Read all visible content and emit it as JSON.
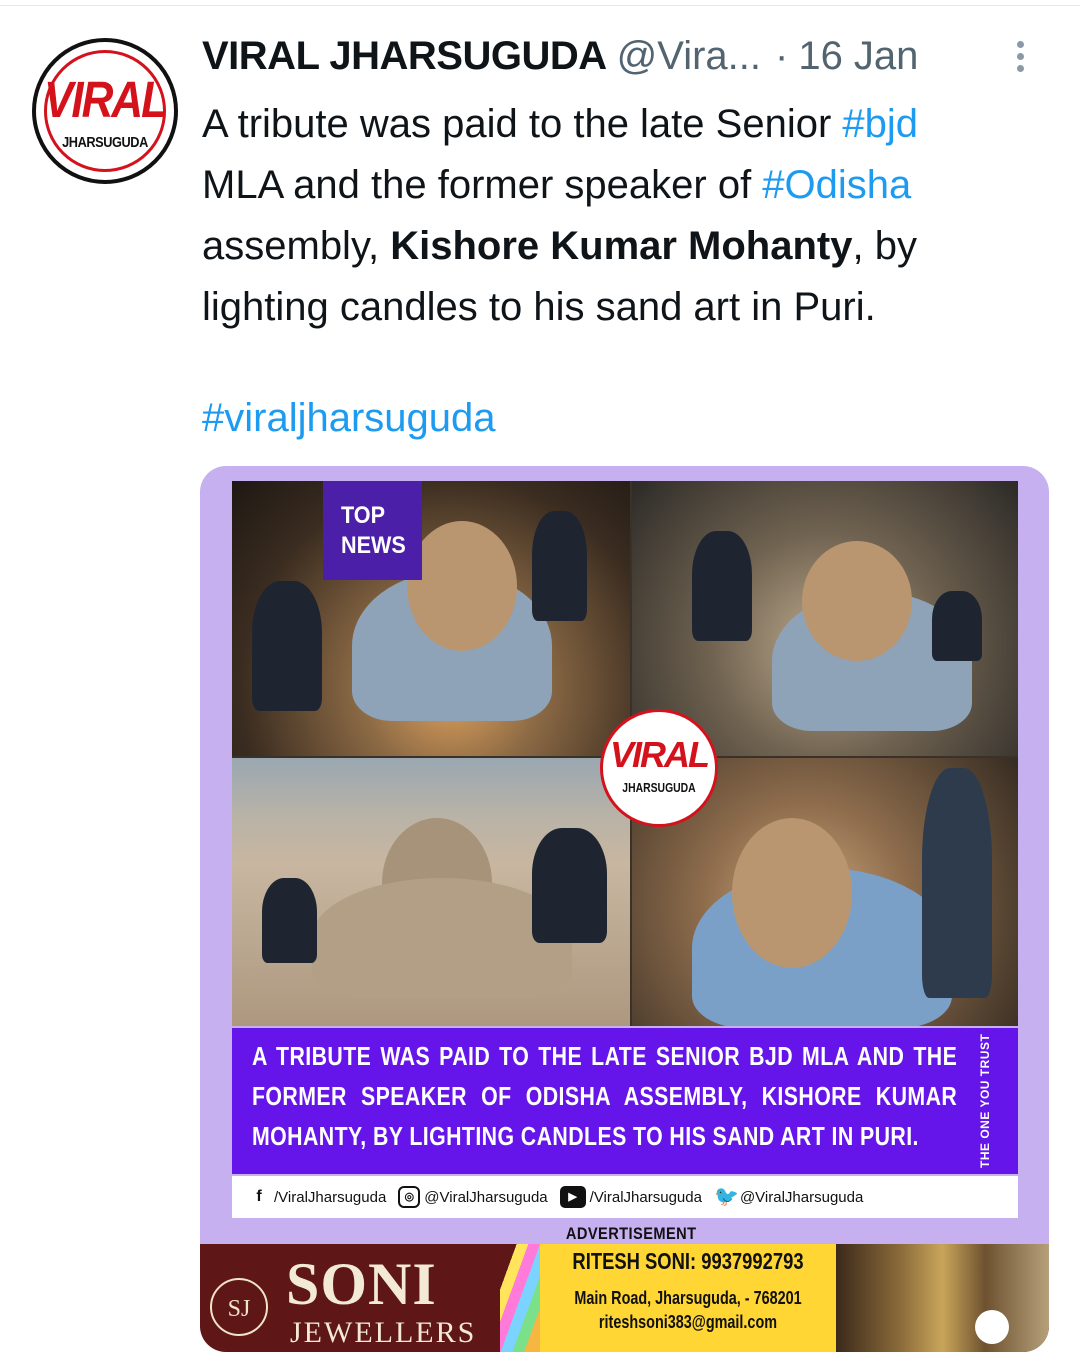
{
  "tweet": {
    "display_name": "VIRAL JHARSUGUDA",
    "handle": "@Vira...",
    "separator": "·",
    "date": "16 Jan",
    "avatar": {
      "line1": "VIRAL",
      "line2": "JHARSUGUDA"
    },
    "text": {
      "l1_pre": "A tribute was paid to the late Senior ",
      "l1_tag": "#bjd",
      "l2_pre": "MLA and the former speaker of ",
      "l2_tag": "#Odisha",
      "l3_pre": "assembly, ",
      "l3_bold": "Kishore Kumar Mohanty",
      "l3_post": ",  by",
      "l4": "lighting candles to his sand art in Puri.",
      "hashtag": "#viraljharsuguda"
    }
  },
  "media": {
    "top_news_line1": "TOP",
    "top_news_line2": "NEWS",
    "center_logo": {
      "line1": "VIRAL",
      "line2": "JHARSUGUDA"
    },
    "banner_text": "A TRIBUTE WAS PAID TO THE LATE SENIOR BJD MLA AND THE FORMER SPEAKER OF ODISHA ASSEMBLY, KISHORE KUMAR MOHANTY, BY LIGHTING CANDLES TO HIS SAND ART IN PURI.",
    "tagline": "THE ONE YOU TRUST",
    "social": {
      "facebook": "/ViralJharsuguda",
      "instagram": "@ViralJharsuguda",
      "youtube": "/ViralJharsuguda",
      "twitter": "@ViralJharsuguda"
    },
    "ad_label": "ADVERTISEMENT",
    "ad": {
      "logo": "SJ",
      "brand": "SONI",
      "subtitle": "JEWELLERS",
      "phone": "RITESH SONI: 9937992793",
      "address": "Main Road, Jharsuguda, - 768201",
      "email": "riteshsoni383@gmail.com"
    }
  },
  "colors": {
    "link": "#1d9bf0",
    "muted": "#536471",
    "card_bg": "#c7b0f0",
    "banner": "#6515e9",
    "brand_red": "#d4121c"
  },
  "icons": [
    "more-vertical-icon",
    "facebook-icon",
    "instagram-icon",
    "youtube-icon",
    "twitter-icon"
  ]
}
